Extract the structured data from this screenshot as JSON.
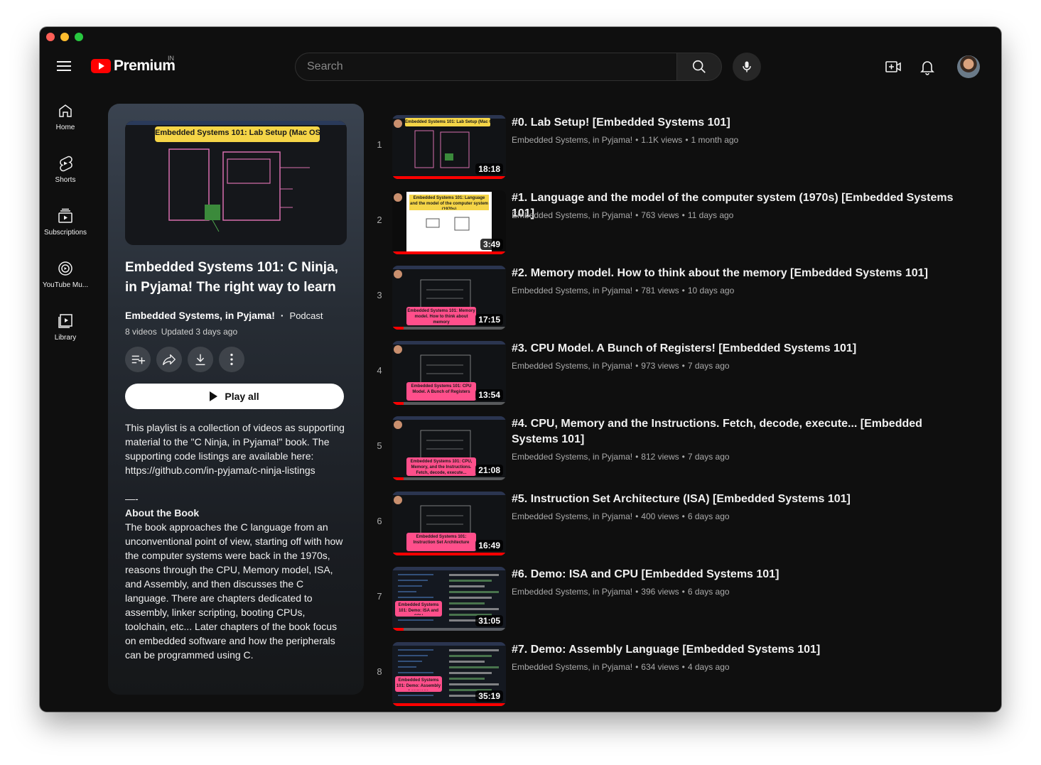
{
  "header": {
    "logo_text": "Premium",
    "region": "IN",
    "search_placeholder": "Search"
  },
  "rail": [
    {
      "label": "Home",
      "icon": "home-icon"
    },
    {
      "label": "Shorts",
      "icon": "shorts-icon"
    },
    {
      "label": "Subscriptions",
      "icon": "subscriptions-icon"
    },
    {
      "label": "YouTube Mu...",
      "icon": "youtube-music-icon"
    },
    {
      "label": "Library",
      "icon": "library-icon"
    }
  ],
  "playlist": {
    "thumb_title": "Embedded Systems 101: Lab Setup (Mac OS)",
    "title": "Embedded Systems 101: C Ninja, in Pyjama! The right way to learn C...",
    "channel": "Embedded Systems, in Pyjama!",
    "separator": "·",
    "type": "Podcast",
    "video_count": "8 videos",
    "updated": "Updated 3 days ago",
    "play_all": "Play all",
    "description_intro": "This playlist is a collection of videos as supporting material to the \"C Ninja, in Pyjama!\" book. The supporting code listings are available here: https://github.com/in-pyjama/c-ninja-listings",
    "description_sep": "—-",
    "description_about": "About the Book",
    "description_body": "The book approaches the C language from an unconventional point of view, starting off with how the computer systems were back in the 1970s, reasons through the CPU, Memory model, ISA, and Assembly, and then discusses the C language. There are chapters dedicated to assembly, linker scripting, booting CPUs, toolchain, etc... Later chapters of the book focus on embedded software and how the peripherals can be programmed using C."
  },
  "videos": [
    {
      "index": "1",
      "title": "#0. Lab Setup! [Embedded Systems 101]",
      "channel": "Embedded Systems, in Pyjama!",
      "views": "1.1K views",
      "age": "1 month ago",
      "duration": "18:18",
      "progress": 1.0,
      "lines": 1,
      "thumb_label": "Embedded Systems 101: Lab Setup (Mac OS)",
      "thumb_style": "dark"
    },
    {
      "index": "2",
      "title": "#1. Language and the model of the computer system (1970s) [Embedded Systems 101]",
      "channel": "Embedded Systems, in Pyjama!",
      "views": "763 views",
      "age": "11 days ago",
      "duration": "3:49",
      "progress": 1.0,
      "lines": 1,
      "thumb_label": "Embedded Systems 101: Language and the model of the computer system (1970s)",
      "thumb_style": "white"
    },
    {
      "index": "3",
      "title": "#2. Memory model. How to think about the memory [Embedded Systems 101]",
      "channel": "Embedded Systems, in Pyjama!",
      "views": "781 views",
      "age": "10 days ago",
      "duration": "17:15",
      "progress": 0.1,
      "lines": 1,
      "thumb_label": "Embedded Systems 101: Memory model. How to think about memory",
      "thumb_style": "pink"
    },
    {
      "index": "4",
      "title": "#3. CPU Model. A Bunch of Registers! [Embedded Systems 101]",
      "channel": "Embedded Systems, in Pyjama!",
      "views": "973 views",
      "age": "7 days ago",
      "duration": "13:54",
      "progress": 0.1,
      "lines": 1,
      "thumb_label": "Embedded Systems 101: CPU Model. A Bunch of Registers",
      "thumb_style": "pink"
    },
    {
      "index": "5",
      "title": "#4. CPU, Memory and the Instructions. Fetch, decode, execute... [Embedded Systems 101]",
      "channel": "Embedded Systems, in Pyjama!",
      "views": "812 views",
      "age": "7 days ago",
      "duration": "21:08",
      "progress": 0.1,
      "lines": 2,
      "thumb_label": "Embedded Systems 101: CPU, Memory, and the Instructions. Fetch, decode, execute...",
      "thumb_style": "pink"
    },
    {
      "index": "6",
      "title": "#5. Instruction Set Architecture (ISA) [Embedded Systems 101]",
      "channel": "Embedded Systems, in Pyjama!",
      "views": "400 views",
      "age": "6 days ago",
      "duration": "16:49",
      "progress": 1.0,
      "lines": 1,
      "thumb_label": "Embedded Systems 101: Instruction Set Architecture",
      "thumb_style": "pink"
    },
    {
      "index": "7",
      "title": "#6. Demo: ISA and CPU [Embedded Systems 101]",
      "channel": "Embedded Systems, in Pyjama!",
      "views": "396 views",
      "age": "6 days ago",
      "duration": "31:05",
      "progress": 0.1,
      "lines": 1,
      "thumb_label": "Embedded Systems 101: Demo: ISA and CPU",
      "thumb_style": "term"
    },
    {
      "index": "8",
      "title": "#7. Demo: Assembly Language [Embedded Systems 101]",
      "channel": "Embedded Systems, in Pyjama!",
      "views": "634 views",
      "age": "4 days ago",
      "duration": "35:19",
      "progress": 1.0,
      "lines": 1,
      "thumb_label": "Embedded Systems 101: Demo: Assembly Language",
      "thumb_style": "term"
    }
  ],
  "colors": {
    "accent": "#ff0000",
    "background": "#0f0f0f",
    "label_yellow": "#f5d547",
    "label_pink": "#ff4f8b"
  }
}
